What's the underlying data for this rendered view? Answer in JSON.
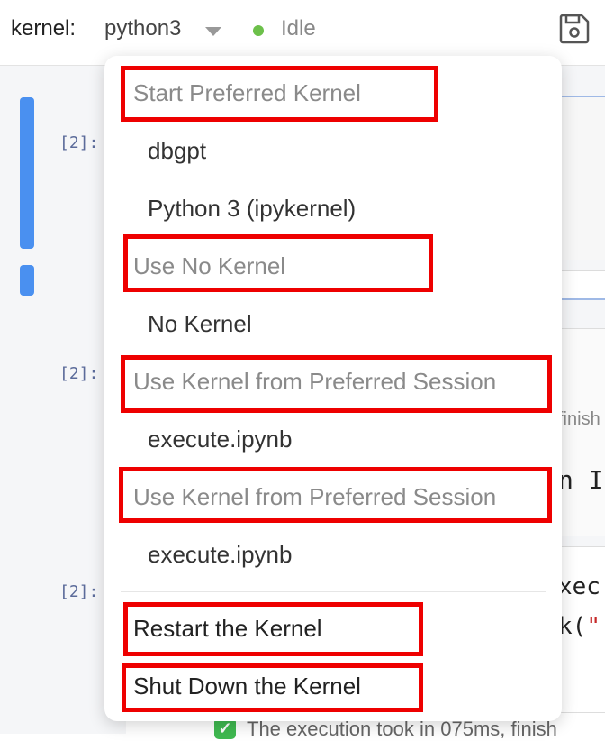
{
  "toolbar": {
    "kernel_label": "kernel:",
    "kernel_name": "python3",
    "status": "Idle",
    "status_color": "#6cc04a",
    "save_icon": "save-icon"
  },
  "notebook": {
    "prompts": [
      "[2]:",
      "[2]:",
      "[2]:"
    ],
    "snippets": {
      "s1": "finish",
      "s2": "n IF",
      "s3": "xec",
      "s4_pre": "k(",
      "s4_str": "\"",
      "s5": "The execution took in 075ms, finish"
    }
  },
  "menu": {
    "header_start_preferred": "Start Preferred Kernel",
    "option_dbgpt": "dbgpt",
    "option_python3": "Python 3 (ipykernel)",
    "header_use_no_kernel": "Use No Kernel",
    "option_no_kernel": "No Kernel",
    "header_session_1": "Use Kernel from Preferred Session",
    "option_session_1": "execute.ipynb",
    "header_session_2": "Use Kernel from Preferred Session",
    "option_session_2": "execute.ipynb",
    "action_restart": "Restart the Kernel",
    "action_shutdown": "Shut Down the Kernel"
  },
  "highlight_color": "#ee0000"
}
